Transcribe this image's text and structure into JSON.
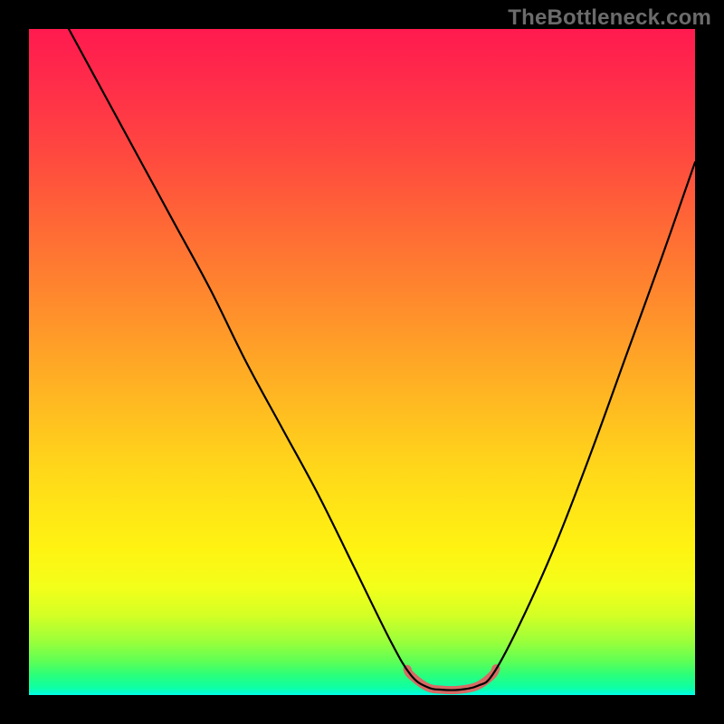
{
  "watermark": "TheBottleneck.com",
  "chart_data": {
    "type": "line",
    "title": "",
    "xlabel": "",
    "ylabel": "",
    "xlim": [
      0,
      736
    ],
    "ylim": [
      0,
      100
    ],
    "series": [
      {
        "name": "bottleneck-curve",
        "x": [
          44,
          80,
          120,
          160,
          200,
          240,
          280,
          320,
          360,
          400,
          422,
          440,
          456,
          476,
          496,
          512,
          540,
          580,
          620,
          660,
          700,
          736
        ],
        "y_pct": [
          100,
          91,
          81,
          71,
          61,
          50,
          40,
          30,
          19,
          8,
          3,
          1.2,
          0.8,
          0.8,
          1.4,
          3,
          10,
          22,
          36,
          51,
          66,
          80
        ]
      }
    ],
    "highlight_range_x": [
      418,
      516
    ],
    "gradient_colors": {
      "top": "#ff1a4f",
      "mid": "#ffd71a",
      "bottom_green": "#2aff7a",
      "bottom_cyan": "#00ffe8"
    },
    "highlight_color": "#d86a64",
    "curve_color": "#000000"
  }
}
